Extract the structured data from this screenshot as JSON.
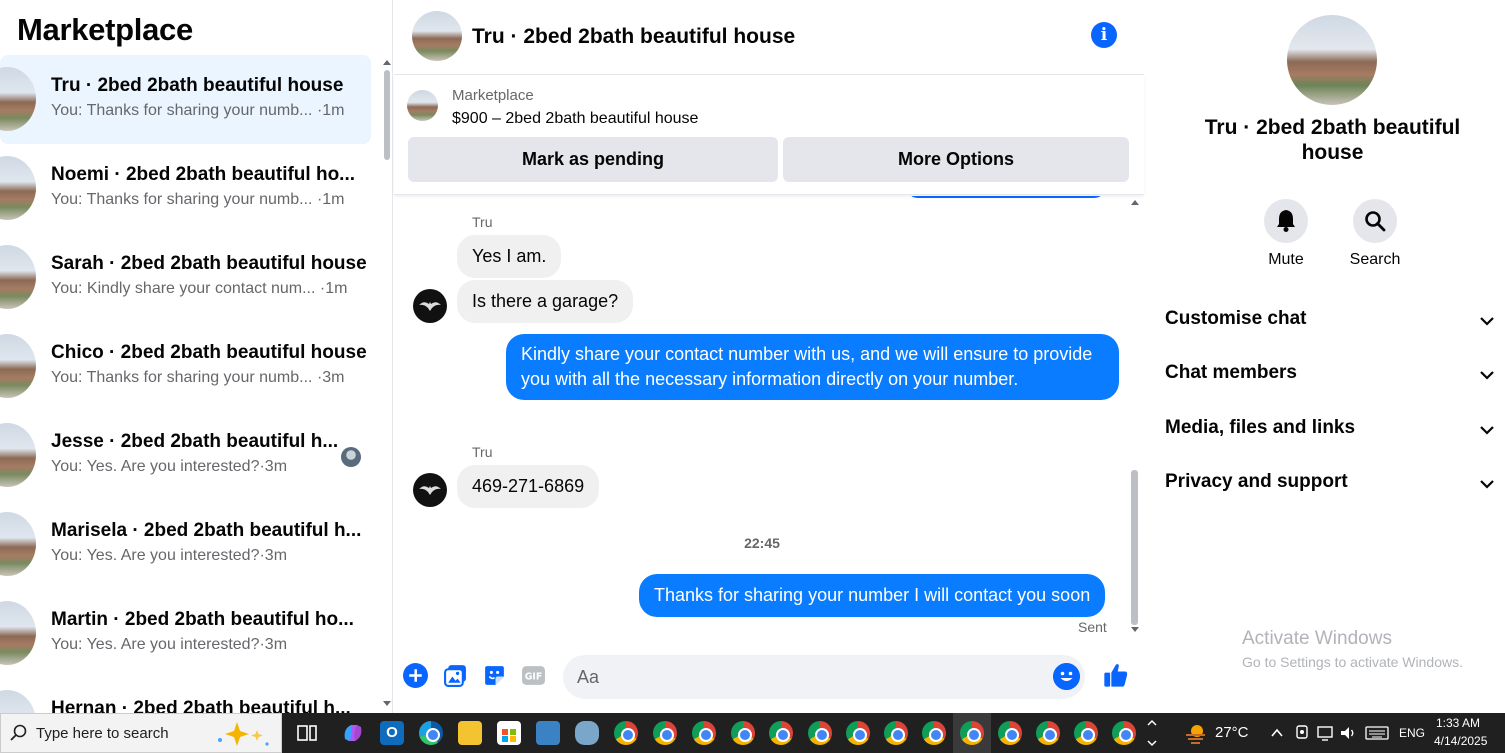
{
  "sidebar": {
    "title": "Marketplace",
    "conversations": [
      {
        "name": "Tru · 2bed 2bath beautiful house",
        "snippet": "You: Thanks for sharing your numb...",
        "time": "·1m"
      },
      {
        "name": "Noemi · 2bed 2bath beautiful ho...",
        "snippet": "You: Thanks for sharing your numb...",
        "time": "·1m"
      },
      {
        "name": "Sarah · 2bed 2bath beautiful house",
        "snippet": "You: Kindly share your contact num...",
        "time": "·1m"
      },
      {
        "name": "Chico · 2bed 2bath beautiful house",
        "snippet": "You: Thanks for sharing your numb...",
        "time": "·3m"
      },
      {
        "name": "Jesse · 2bed 2bath beautiful h...",
        "snippet": "You: Yes. Are you interested?",
        "time": "·3m"
      },
      {
        "name": "Marisela · 2bed 2bath beautiful h...",
        "snippet": "You: Yes. Are you interested?",
        "time": "·3m"
      },
      {
        "name": "Martin · 2bed 2bath beautiful ho...",
        "snippet": "You: Yes. Are you interested?",
        "time": "·3m"
      },
      {
        "name": "Hernan · 2bed 2bath beautiful h...",
        "snippet": "",
        "time": ""
      }
    ]
  },
  "chat": {
    "title": "Tru · 2bed 2bath beautiful house",
    "marketplace_label": "Marketplace",
    "listing": "$900 – 2bed 2bath beautiful house",
    "mark_pending_label": "Mark as pending",
    "more_options_label": "More Options",
    "messages": [
      {
        "sender": "Tru",
        "text": "Yes I am."
      },
      {
        "text": "Is there a garage?"
      },
      {
        "text": "Kindly share your contact number with us, and we will ensure to provide you with all the necessary information directly on your number."
      },
      {
        "sender": "Tru",
        "text": "469-271-6869"
      },
      {
        "text": "Thanks for sharing your number I will contact you soon"
      }
    ],
    "timestamp": "22:45",
    "status": "Sent",
    "composer_placeholder": "Aa"
  },
  "details": {
    "name": "Tru · 2bed 2bath beautiful house",
    "mute_label": "Mute",
    "search_label": "Search",
    "sections": [
      "Customise chat",
      "Chat members",
      "Media, files and links",
      "Privacy and support"
    ],
    "watermark_title": "Activate Windows",
    "watermark_sub": "Go to Settings to activate Windows."
  },
  "taskbar": {
    "search_placeholder": "Type here to search",
    "temperature": "27°C",
    "language": "ENG",
    "time": "1:33 AM",
    "date": "4/14/2025"
  },
  "colors": {
    "accent": "#0866ff",
    "bubble_out": "#0a7cff",
    "bubble_in": "#f0f0f0"
  }
}
